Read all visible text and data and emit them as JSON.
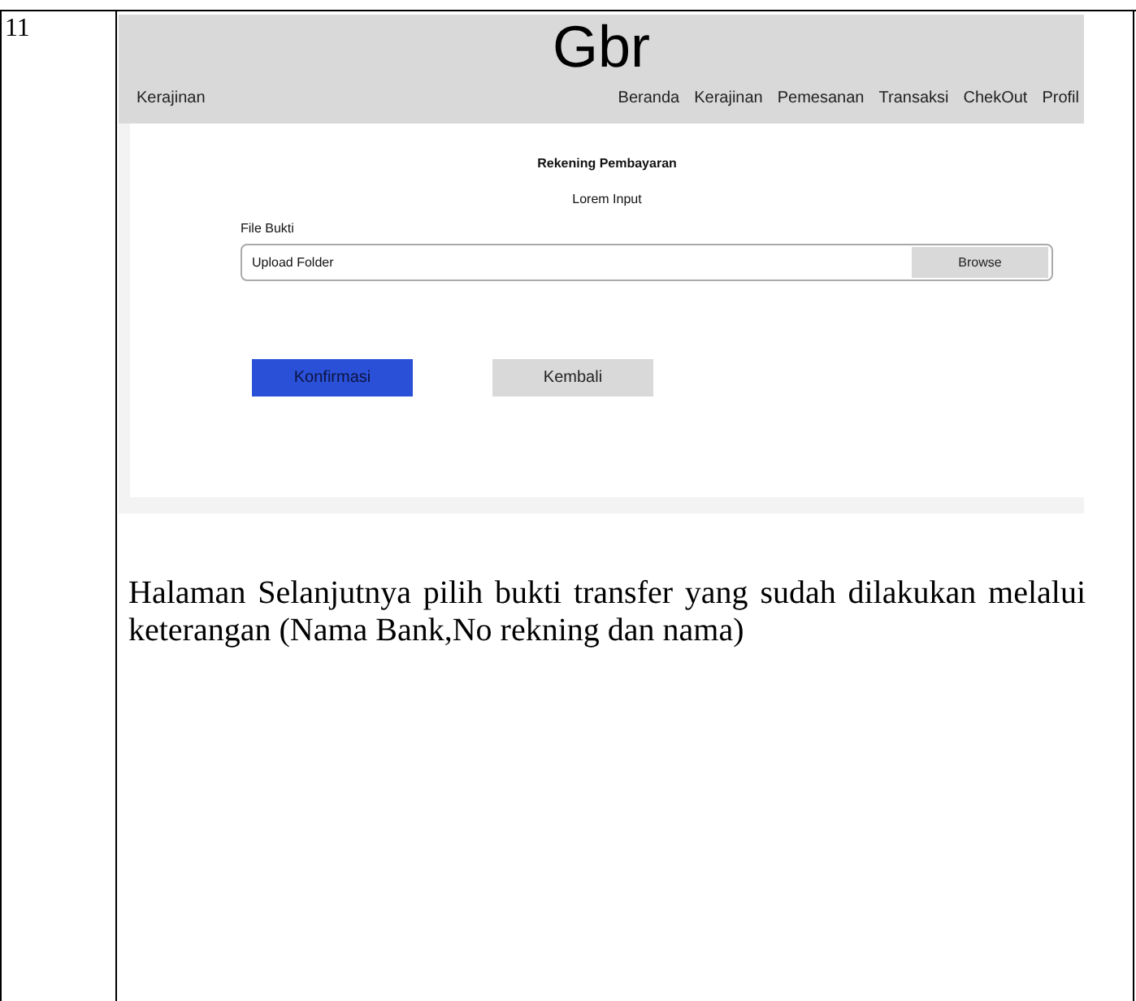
{
  "row_number": "11",
  "mockup": {
    "header_title": "Gbr",
    "brand": "Kerajinan",
    "nav": [
      "Beranda",
      "Kerajinan",
      "Pemesanan",
      "Transaksi",
      "ChekOut",
      "Profil"
    ],
    "heading": "Rekening Pembayaran",
    "info": "Lorem Input",
    "file_label": "File Bukti",
    "file_field": {
      "placeholder": "Upload Folder",
      "button": "Browse"
    },
    "buttons": [
      {
        "label": "Konfirmasi",
        "kind": "primary"
      },
      {
        "label": "Kembali",
        "kind": "secondary"
      }
    ]
  },
  "description": "Halaman Selanjutnya pilih bukti transfer yang sudah dilakukan melalui keterangan (Nama Bank,No rekning dan nama)"
}
